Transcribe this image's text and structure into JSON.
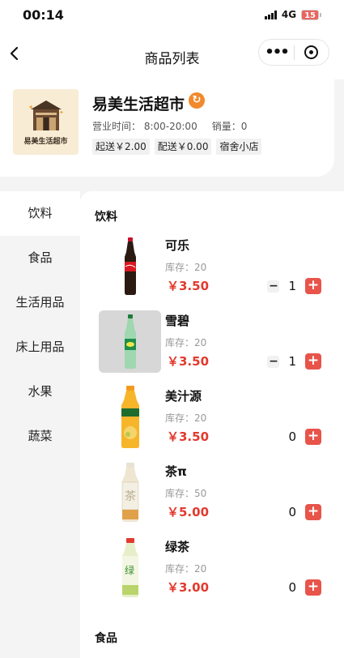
{
  "status_bar": {
    "time": "00:14",
    "network": "4G",
    "battery": "15"
  },
  "nav": {
    "title": "商品列表",
    "more": "•••"
  },
  "store": {
    "logo_text": "易美生活超市",
    "name": "易美生活超市",
    "badge": "↻",
    "hours_label": "营业时间：",
    "hours": "8:00-20:00",
    "sales_label": "销量：",
    "sales": "0",
    "tags": [
      "起送￥2.00",
      "配送￥0.00",
      "宿舍小店"
    ]
  },
  "categories": [
    "饮料",
    "食品",
    "生活用品",
    "床上用品",
    "水果",
    "蔬菜"
  ],
  "sections": [
    {
      "title": "饮料",
      "products": [
        {
          "name": "可乐",
          "stock": "库存：20",
          "price": "￥3.50",
          "qty": "1"
        },
        {
          "name": "雪碧",
          "stock": "库存：20",
          "price": "￥3.50",
          "qty": "1"
        },
        {
          "name": "美汁源",
          "stock": "库存：20",
          "price": "￥3.50",
          "qty": "0"
        },
        {
          "name": "茶π",
          "stock": "库存：50",
          "price": "￥5.00",
          "qty": "0"
        },
        {
          "name": "绿茶",
          "stock": "库存：20",
          "price": "￥3.00",
          "qty": "0"
        }
      ]
    },
    {
      "title": "食品",
      "products": []
    }
  ],
  "controls": {
    "minus": "−",
    "plus": "+"
  },
  "colors": {
    "price": "#e23a2e",
    "add_button": "#e8544a",
    "badge": "#f08a2c"
  }
}
